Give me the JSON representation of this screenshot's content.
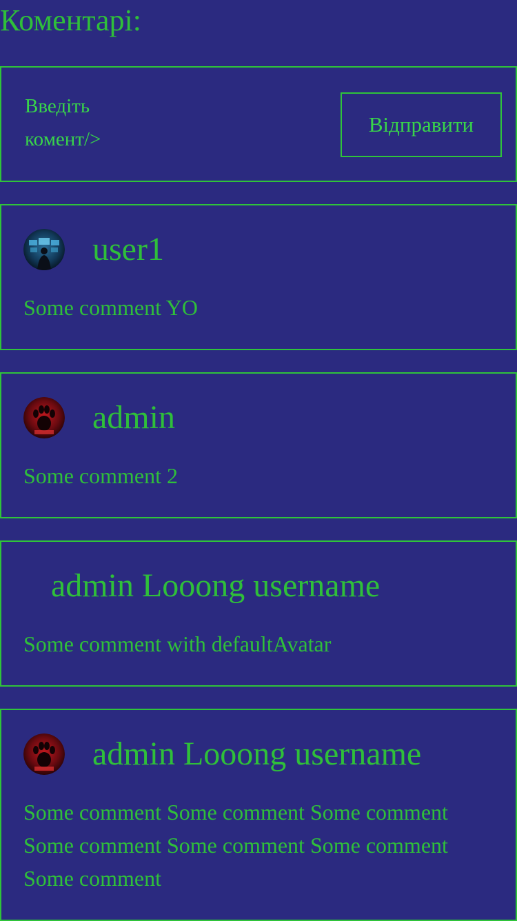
{
  "heading": "Коментарі:",
  "form": {
    "input_placeholder": "Введіть комент/>",
    "send_label": "Відправити"
  },
  "comments": [
    {
      "username": "user1",
      "text": "Some comment YO",
      "avatar": "monitors-avatar"
    },
    {
      "username": "admin",
      "text": "Some comment 2",
      "avatar": "red-paw-avatar"
    },
    {
      "username": "admin Looong username",
      "text": "Some comment with defaultAvatar",
      "avatar": "default-avatar"
    },
    {
      "username": "admin Looong username",
      "text": "Some comment Some comment Some comment Some comment Some comment Some comment Some comment",
      "avatar": "red-paw-avatar"
    }
  ],
  "colors": {
    "background": "#2b2a80",
    "accent": "#2fbf3a"
  }
}
